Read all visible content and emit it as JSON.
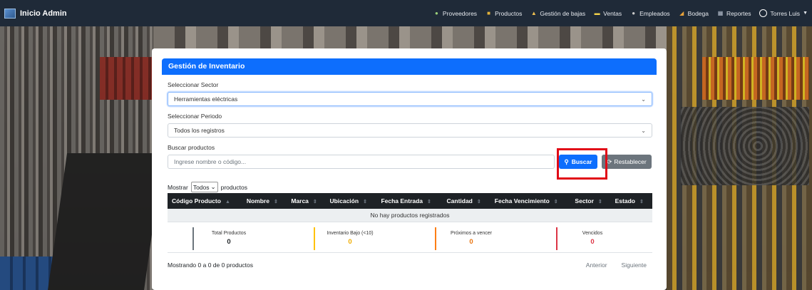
{
  "navbar": {
    "brand": "Inicio Admin",
    "items": [
      {
        "label": "Proveedores",
        "icon": "people-icon"
      },
      {
        "label": "Productos",
        "icon": "box-icon"
      },
      {
        "label": "Gestión de bajas",
        "icon": "trash-icon"
      },
      {
        "label": "Ventas",
        "icon": "cash-icon"
      },
      {
        "label": "Empleados",
        "icon": "person-icon"
      },
      {
        "label": "Bodega",
        "icon": "warehouse-icon"
      },
      {
        "label": "Reportes",
        "icon": "report-icon"
      }
    ],
    "user": "Torres Luis"
  },
  "card": {
    "title": "Gestión de Inventario",
    "sector_label": "Seleccionar Sector",
    "sector_value": "Herramientas eléctricas",
    "period_label": "Seleccionar Periodo",
    "period_value": "Todos los registros",
    "search_label": "Buscar productos",
    "search_placeholder": "Ingrese nombre o código...",
    "search_button": "Buscar",
    "reset_button": "Restablecer",
    "show_prefix": "Mostrar",
    "show_value": "Todos",
    "show_suffix": "productos"
  },
  "table": {
    "columns": [
      "Código Producto",
      "Nombre",
      "Marca",
      "Ubicación",
      "Fecha Entrada",
      "Cantidad",
      "Fecha Vencimiento",
      "Sector",
      "Estado"
    ],
    "empty_message": "No hay productos registrados"
  },
  "stats": [
    {
      "title": "Total Productos",
      "value": "0",
      "color": "#212529",
      "border": "#6c757d"
    },
    {
      "title": "Inventario Bajo (<10)",
      "value": "0",
      "color": "#f0ad00",
      "border": "#ffc107"
    },
    {
      "title": "Próximos a vencer",
      "value": "0",
      "color": "#e8740f",
      "border": "#fd7e14"
    },
    {
      "title": "Vencidos",
      "value": "0",
      "color": "#dc3545",
      "border": "#dc3545"
    }
  ],
  "footer": {
    "info": "Mostrando 0 a 0 de 0 productos",
    "prev": "Anterior",
    "next": "Siguiente"
  },
  "colors": {
    "navbar": "#1f2a38",
    "primary": "#0d6efd",
    "secondary": "#6c757d",
    "highlight": "#e10a17"
  }
}
